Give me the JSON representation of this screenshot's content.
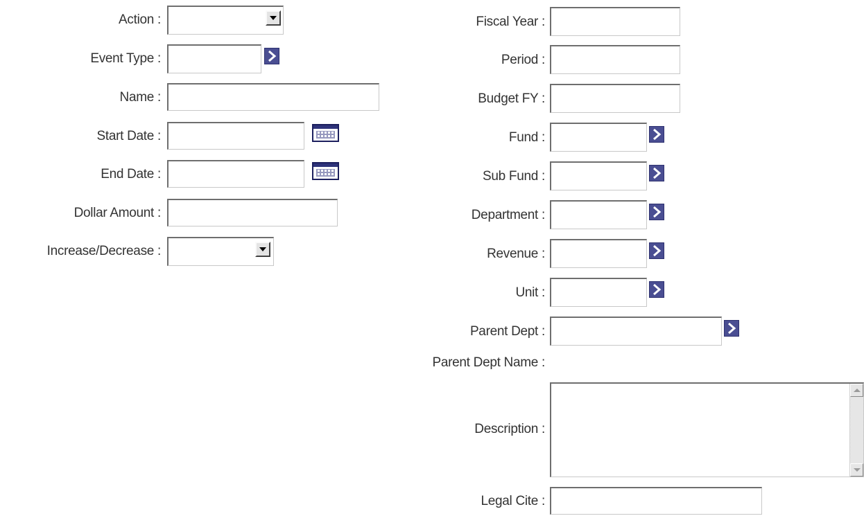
{
  "left_form": {
    "action_label": "Action :",
    "event_type_label": "Event Type :",
    "name_label": "Name :",
    "start_date_label": "Start Date :",
    "end_date_label": "End Date :",
    "dollar_amount_label": "Dollar Amount :",
    "increase_decrease_label": "Increase/Decrease :"
  },
  "right_form": {
    "fiscal_year_label": "Fiscal Year :",
    "period_label": "Period :",
    "budget_fy_label": "Budget FY :",
    "fund_label": "Fund :",
    "sub_fund_label": "Sub Fund :",
    "department_label": "Department :",
    "revenue_label": "Revenue :",
    "unit_label": "Unit :",
    "parent_dept_label": "Parent Dept :",
    "parent_dept_name_label": "Parent Dept Name :",
    "description_label": "Description :",
    "legal_cite_label": "Legal Cite :"
  },
  "values": {
    "action": "",
    "event_type": "",
    "name": "",
    "start_date": "",
    "end_date": "",
    "dollar_amount": "",
    "increase_decrease": "",
    "fiscal_year": "",
    "period": "",
    "budget_fy": "",
    "fund": "",
    "sub_fund": "",
    "department": "",
    "revenue": "",
    "unit": "",
    "parent_dept": "",
    "parent_dept_name": "",
    "description": "",
    "legal_cite": ""
  },
  "icons": {
    "dropdown": "chevron-down-icon",
    "lookup": "lookup-arrow-icon",
    "calendar": "calendar-icon"
  },
  "colors": {
    "lookup_button": "#4a4e92",
    "calendar_frame": "#1c1f5e",
    "label_text": "#333333"
  }
}
